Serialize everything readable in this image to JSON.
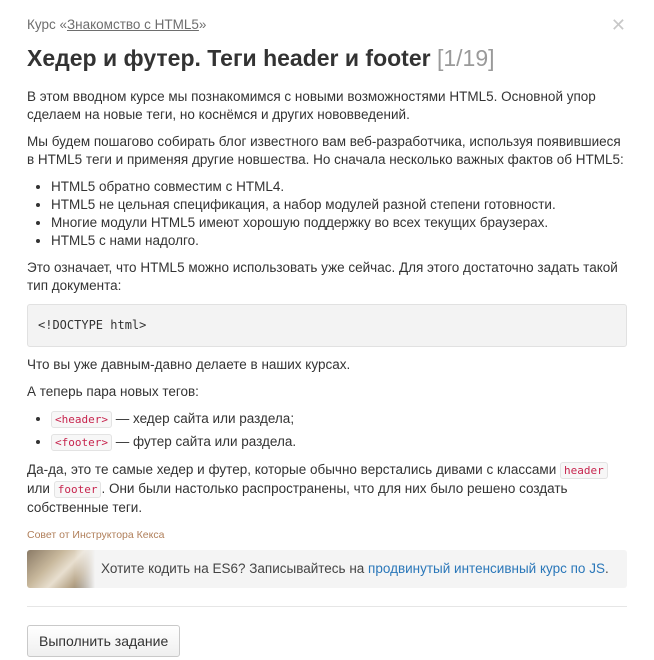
{
  "breadcrumb": {
    "prefix": "Курс «",
    "course_link": "Знакомство с HTML5",
    "suffix": "»"
  },
  "close_icon": "✕",
  "header": {
    "title": "Хедер и футер. Теги header и footer",
    "counter": "[1/19]"
  },
  "content": {
    "intro": "В этом вводном курсе мы познакомимся с новыми возможностями HTML5. Основной упор сделаем на новые теги, но коснёмся и других нововведений.",
    "para2": "Мы будем пошагово собирать блог известного вам веб-разработчика, используя появившиеся в HTML5 теги и применяя другие новшества. Но сначала несколько важных фактов об HTML5:",
    "facts": [
      "HTML5 обратно совместим с HTML4.",
      "HTML5 не цельная спецификация, а набор модулей разной степени готовности.",
      "Многие модули HTML5 имеют хорошую поддержку во всех текущих браузерах.",
      "HTML5 с нами надолго."
    ],
    "para3": "Это означает, что HTML5 можно использовать уже сейчас. Для этого достаточно задать такой тип документа:",
    "doctype_code": "<!DOCTYPE html>",
    "para4": "Что вы уже давным-давно делаете в наших курсах.",
    "para5": "А теперь пара новых тегов:",
    "tags": [
      {
        "code": "<header>",
        "desc": " — хедер сайта или раздела;"
      },
      {
        "code": "<footer>",
        "desc": " — футер сайта или раздела."
      }
    ],
    "para6": {
      "part1": "Да-да, это те самые хедер и футер, которые обычно верстались дивами с классами ",
      "code1": "header",
      "part2": " или ",
      "code2": "footer",
      "part3": ". Они были настолько распространены, что для них было решено создать собственные теги."
    }
  },
  "tip": {
    "label": "Совет от Инструктора Кекса",
    "text": "Хотите кодить на ES6? Записывайтесь на ",
    "link": "продвинутый интенсивный курс по JS",
    "end": "."
  },
  "actions": {
    "submit_label": "Выполнить задание"
  }
}
